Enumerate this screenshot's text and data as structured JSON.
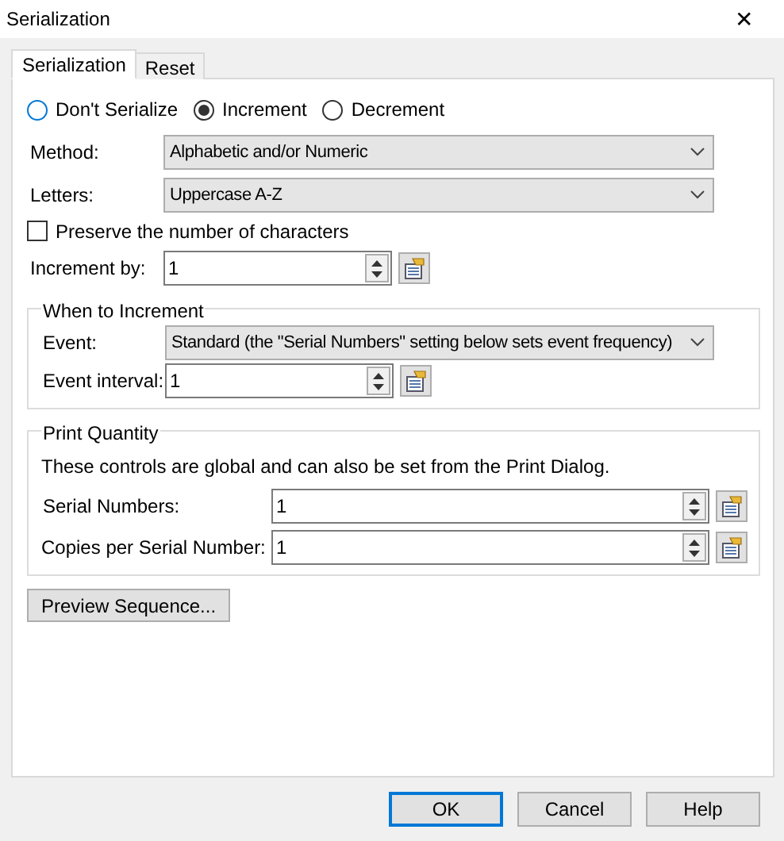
{
  "window": {
    "title": "Serialization",
    "close": "✕"
  },
  "tabs": [
    {
      "label": "Serialization",
      "selected": true
    },
    {
      "label": "Reset",
      "selected": false
    }
  ],
  "mode": [
    {
      "label": "Don't Serialize",
      "selected": false
    },
    {
      "label": "Increment",
      "selected": true
    },
    {
      "label": "Decrement",
      "selected": false
    }
  ],
  "method": {
    "label": "Method:",
    "value": "Alphabetic and/or Numeric"
  },
  "letters": {
    "label": "Letters:",
    "value": "Uppercase A-Z"
  },
  "preserve": {
    "label": "Preserve the number of characters",
    "checked": false
  },
  "increment_by": {
    "label": "Increment by:",
    "value": "1"
  },
  "when_to_increment": {
    "title": "When to Increment",
    "event": {
      "label": "Event:",
      "value": "Standard (the \"Serial Numbers\" setting below sets event frequency)"
    },
    "event_interval": {
      "label": "Event interval:",
      "value": "1"
    }
  },
  "print_quantity": {
    "title": "Print Quantity",
    "note": "These controls are global and can also be set from the Print Dialog.",
    "serial_numbers": {
      "label": "Serial Numbers:",
      "value": "1"
    },
    "copies": {
      "label": "Copies per Serial Number:",
      "value": "1"
    }
  },
  "preview_button": "Preview Sequence...",
  "buttons": [
    {
      "label": "OK",
      "default": true
    },
    {
      "label": "Cancel",
      "default": false
    },
    {
      "label": "Help",
      "default": false
    }
  ]
}
